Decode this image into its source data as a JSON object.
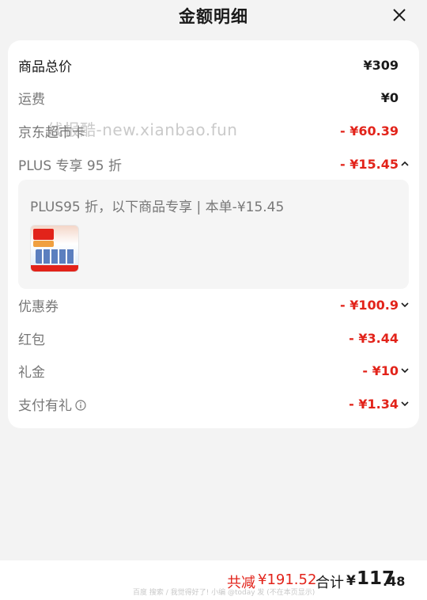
{
  "header": {
    "title": "金额明细"
  },
  "watermark": "线报酷-new.xianbao.fun",
  "rows": [
    {
      "label": "商品总价",
      "value": "¥309"
    },
    {
      "label": "运费",
      "value": "¥0"
    },
    {
      "label": "京东超市卡",
      "value": "- ¥60.39"
    },
    {
      "label": "PLUS 专享 95 折",
      "value": "- ¥15.45"
    },
    {
      "label": "优惠券",
      "value": "- ¥100.9"
    },
    {
      "label": "红包",
      "value": "- ¥3.44"
    },
    {
      "label": "礼金",
      "value": "- ¥10"
    },
    {
      "label": "支付有礼",
      "value": "- ¥1.34"
    }
  ],
  "plus_detail": {
    "note": "PLUS95 折，以下商品专享 | 本单-¥15.45",
    "product_image_text": [
      "营养满贯",
      "一次囤够",
      "至江京满999减300"
    ]
  },
  "footer": {
    "saved_label": "共减",
    "saved_value": "¥191.52",
    "total_label": "合计",
    "total_currency": "¥",
    "total_int": "117",
    "total_dec": ".48",
    "footnote": "百度 搜索 / 我觉得好了! 小编 @today 发 (不在本页显示)"
  },
  "colors": {
    "accent_red": "#e2231a",
    "card_bg": "#ffffff",
    "page_bg": "#f3f3f3"
  }
}
